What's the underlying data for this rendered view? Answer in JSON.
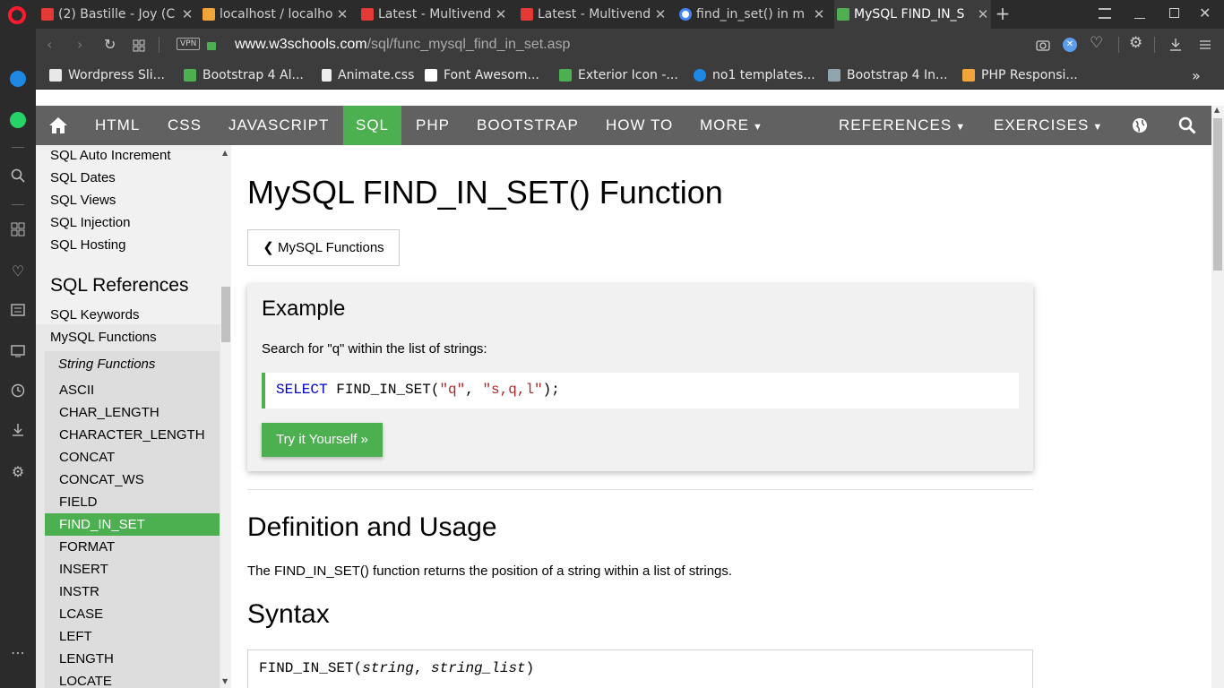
{
  "browser": {
    "tabs": [
      {
        "title": "(2) Bastille - Joy (C",
        "favicon_color": "#e53935"
      },
      {
        "title": "localhost / localho",
        "favicon_color": "#f2a33a"
      },
      {
        "title": "Latest - Multivend",
        "favicon_color": "#e53935"
      },
      {
        "title": "Latest - Multivend",
        "favicon_color": "#e53935"
      },
      {
        "title": "find_in_set() in m",
        "favicon_color": "#4285f4"
      },
      {
        "title": "MySQL FIND_IN_S",
        "favicon_color": "#4caf50"
      }
    ],
    "new_tab": "+",
    "url_domain": "www.w3schools.com",
    "url_path": "/sql/func_mysql_find_in_set.asp",
    "vpn_label": "VPN",
    "bookmarks": [
      {
        "label": "Wordpress Sli...",
        "color": "#e8e8e8"
      },
      {
        "label": "Bootstrap 4 Al...",
        "color": "#4caf50"
      },
      {
        "label": "Animate.css",
        "color": "#eeeeee"
      },
      {
        "label": "Font Awesom...",
        "color": "#ffffff"
      },
      {
        "label": "Exterior Icon -...",
        "color": "#4caf50"
      },
      {
        "label": "no1 templates...",
        "color": "#1e88e5"
      },
      {
        "label": "Bootstrap 4 In...",
        "color": "#90a4ae"
      },
      {
        "label": "PHP Responsi...",
        "color": "#f2a33a"
      }
    ],
    "bookmarks_more": "»"
  },
  "nav": {
    "items": [
      "HTML",
      "CSS",
      "JAVASCRIPT",
      "SQL",
      "PHP",
      "BOOTSTRAP",
      "HOW TO",
      "MORE"
    ],
    "right_items": [
      "REFERENCES",
      "EXERCISES"
    ],
    "active": "SQL"
  },
  "sidebar": {
    "top_items": [
      "SQL Auto Increment",
      "SQL Dates",
      "SQL Views",
      "SQL Injection",
      "SQL Hosting"
    ],
    "references_heading": "SQL References",
    "ref_items": [
      "SQL Keywords",
      "MySQL Functions"
    ],
    "group_label": "String Functions",
    "functions": [
      "ASCII",
      "CHAR_LENGTH",
      "CHARACTER_LENGTH",
      "CONCAT",
      "CONCAT_WS",
      "FIELD",
      "FIND_IN_SET",
      "FORMAT",
      "INSERT",
      "INSTR",
      "LCASE",
      "LEFT",
      "LENGTH",
      "LOCATE"
    ],
    "current": "FIND_IN_SET"
  },
  "main": {
    "title": "MySQL FIND_IN_SET() Function",
    "back_button": "❮ MySQL Functions",
    "example": {
      "heading": "Example",
      "description": "Search for \"q\" within the list of strings:",
      "code_keyword": "SELECT",
      "code_func": " FIND_IN_SET(",
      "code_arg1": "\"q\"",
      "code_sep": ", ",
      "code_arg2": "\"s,q,l\"",
      "code_end": ");",
      "try_button": "Try it Yourself »"
    },
    "definition_heading": "Definition and Usage",
    "definition_text": "The FIND_IN_SET() function returns the position of a string within a list of strings.",
    "syntax_heading": "Syntax",
    "syntax": {
      "func": "FIND_IN_SET(",
      "arg1": "string",
      "sep": ", ",
      "arg2": "string_list",
      "end": ")"
    }
  },
  "colors": {
    "accent": "#4caf50",
    "nav_bg": "#616161",
    "chrome_bg": "#3c3c3c"
  }
}
